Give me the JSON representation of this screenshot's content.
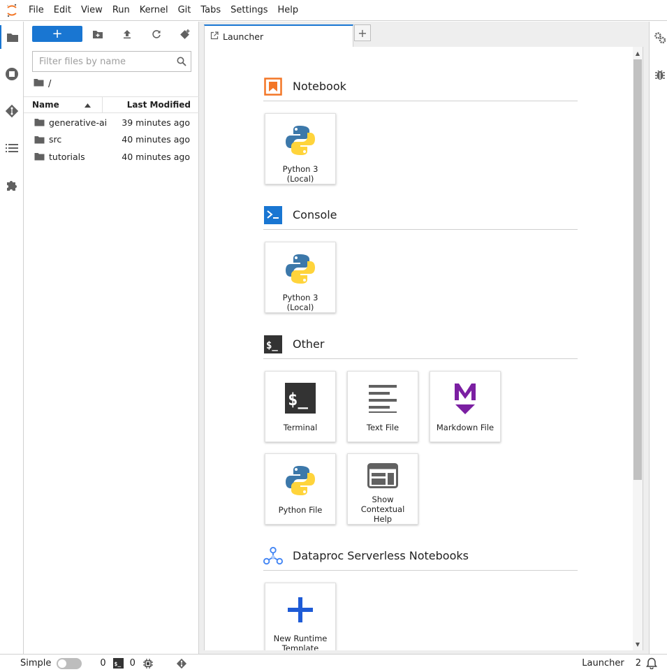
{
  "menu": [
    "File",
    "Edit",
    "View",
    "Run",
    "Kernel",
    "Git",
    "Tabs",
    "Settings",
    "Help"
  ],
  "left_sidebar": {
    "icons": [
      "folder-icon",
      "running-icon",
      "git-icon",
      "toc-icon",
      "extension-icon"
    ],
    "active": "folder-icon"
  },
  "file_browser": {
    "new_button_label": "+",
    "filter_placeholder": "Filter files by name",
    "breadcrumb": "/",
    "columns": {
      "name": "Name",
      "last_modified": "Last Modified"
    },
    "files": [
      {
        "name": "generative-ai",
        "modified": "39 minutes ago"
      },
      {
        "name": "src",
        "modified": "40 minutes ago"
      },
      {
        "name": "tutorials",
        "modified": "40 minutes ago"
      }
    ]
  },
  "tabs": [
    {
      "label": "Launcher",
      "active": true
    }
  ],
  "tab_add_label": "+",
  "launcher": {
    "sections": [
      {
        "title": "Notebook",
        "icon": "notebook-icon",
        "cards": [
          {
            "label": "Python 3 (Local)",
            "icon": "python-logo"
          }
        ]
      },
      {
        "title": "Console",
        "icon": "console-icon",
        "cards": [
          {
            "label": "Python 3 (Local)",
            "icon": "python-logo"
          }
        ]
      },
      {
        "title": "Other",
        "icon": "terminal-icon",
        "cards": [
          {
            "label": "Terminal",
            "icon": "terminal-icon"
          },
          {
            "label": "Text File",
            "icon": "text-file-icon"
          },
          {
            "label": "Markdown File",
            "icon": "markdown-icon"
          },
          {
            "label": "Python File",
            "icon": "python-logo"
          },
          {
            "label": "Show Contextual Help",
            "icon": "contextual-help-icon"
          }
        ]
      },
      {
        "title": "Dataproc Serverless Notebooks",
        "icon": "dataproc-icon",
        "cards": [
          {
            "label": "New Runtime Template",
            "icon": "plus-icon"
          }
        ]
      }
    ]
  },
  "statusbar": {
    "mode_label": "Simple",
    "simple_mode_on": false,
    "terminals_count": "0",
    "kernels_count": "0",
    "active_tab": "Launcher",
    "notifications_count": "2"
  },
  "colors": {
    "accent": "#1976d2",
    "notebook_orange": "#f37626",
    "markdown_purple": "#7b1fa2",
    "terminal_dark": "#333333"
  }
}
